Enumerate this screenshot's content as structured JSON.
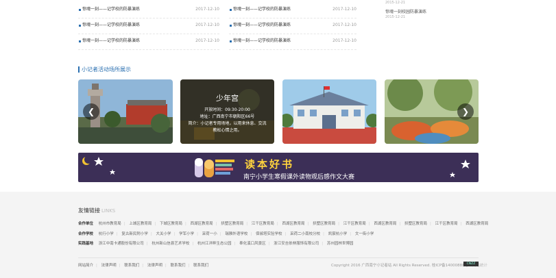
{
  "news": {
    "col1": [
      {
        "title": "惊魂一刻——记学校的防暴演练",
        "date": "2017-12-10"
      },
      {
        "title": "惊魂一刻——记学校的防暴演练",
        "date": "2017-12-10"
      },
      {
        "title": "惊魂一刻——记学校的防暴演练",
        "date": "2017-12-10"
      }
    ],
    "col2": [
      {
        "title": "惊魂一刻——记学校的防暴演练",
        "date": "2017-12-10"
      },
      {
        "title": "惊魂一刻——记学校的防暴演练",
        "date": "2017-12-10"
      },
      {
        "title": "惊魂一刻——记学校的防暴演练",
        "date": "2017-12-10"
      }
    ],
    "side": {
      "prev_date": "2015-12-21",
      "item_title": "惊魂一刻校园防暴演练",
      "item_date": "2015-12-21"
    }
  },
  "section": {
    "title": "小记者活动场所展示"
  },
  "carousel": {
    "overlay": {
      "title": "少年宫",
      "hours": "开放时间：09:30-20:00",
      "address": "地址：广西南宁市朝阳区66号",
      "intro1": "简介：小记者专用场地，以用来休息、交流",
      "intro2": "教松心情之用。"
    },
    "prev_icon": "chevron-left-icon",
    "next_icon": "chevron-right-icon"
  },
  "banner": {
    "big_text": "读本好书",
    "sub_text": "南宁小学生寒假课外读物观后感作文大赛"
  },
  "footer": {
    "links_title": "友情链接",
    "links_title_en": "LINKS",
    "rows": [
      {
        "label": "合作单位",
        "items": [
          "杭州市教育局",
          "上城区教育局",
          "下城区教育局",
          "西湖区教育局",
          "拱墅区教育局",
          "江干区教育局",
          "西湖区教育局",
          "拱墅区教育局",
          "江干区教育局",
          "西湖区教育局",
          "拱墅区教育局",
          "江干区教育局",
          "西湖区教育局"
        ]
      },
      {
        "label": "合作学校",
        "items": [
          "杭行小学",
          "复古新民附小学",
          "大关小学",
          "学军小学",
          "采荷一小",
          "瑞雅外语学校",
          "保俶塔实验学校",
          "采荷二小南校分校",
          "凯宸杭小学",
          "文一街小学"
        ]
      },
      {
        "label": "实践基地",
        "items": [
          "浙江中南卡通股份有限公司",
          "杭州新山信县艺术学校",
          "杭州江洋畔生态公园",
          "奉化溪口风景区",
          "浙江安吉依林服饰有限公司",
          "苏州园林世博园"
        ]
      }
    ],
    "bottom_nav": [
      "网站简介",
      "法律声明",
      "联系我们",
      "法律声明",
      "联系我们",
      "联系我们"
    ],
    "copyright": "Copyright 2016 广西南宁小记者站 All Rights Reserved. 桂ICP备14000888号",
    "stat_link": "网站统计",
    "cnzz_label": "CNZZ"
  }
}
